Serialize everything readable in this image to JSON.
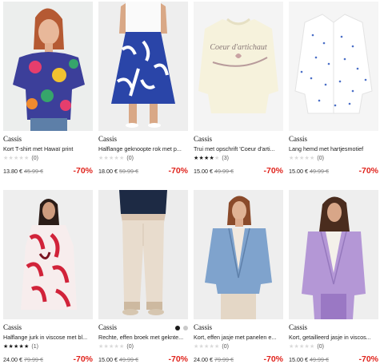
{
  "colors": {
    "discount": "#e0231c",
    "star_on": "#1a1a1a",
    "star_off": "#d9d9d9"
  },
  "products": [
    {
      "brand": "Cassis",
      "title": "Kort T-shirt met Hawaï print",
      "stars": 0,
      "reviews": "(0)",
      "price": "13.80 €",
      "old_price": "45.99 €",
      "discount": "-70%",
      "image": "hawaii-shirt-model"
    },
    {
      "brand": "Cassis",
      "title": "Halflange geknoopte rok met p...",
      "stars": 0,
      "reviews": "(0)",
      "price": "18.00 €",
      "old_price": "59.99 €",
      "discount": "-70%",
      "image": "blue-print-skirt-model"
    },
    {
      "brand": "Cassis",
      "title": "Trui met opschrift 'Coeur d'arti...",
      "stars": 3.5,
      "reviews": "(3)",
      "price": "15.00 €",
      "old_price": "49.99 €",
      "discount": "-70%",
      "image": "sweater-coeur-dartichaut",
      "print_text": "Coeur d'artichaut"
    },
    {
      "brand": "Cassis",
      "title": "Lang hemd met hartjesmotief",
      "stars": 0,
      "reviews": "(0)",
      "price": "15.00 €",
      "old_price": "49.99 €",
      "discount": "-70%",
      "image": "white-heart-shirt"
    },
    {
      "brand": "Cassis",
      "title": "Halflange jurk in viscose met bl...",
      "stars": 5,
      "reviews": "(1)",
      "price": "24.00 €",
      "old_price": "79.99 €",
      "discount": "-70%",
      "image": "floral-dress-model"
    },
    {
      "brand": "Cassis",
      "title": "Rechte, effen broek met geknte...",
      "stars": 0,
      "reviews": "(0)",
      "price": "15.00 €",
      "old_price": "49.99 €",
      "discount": "-70%",
      "image": "beige-trousers-model",
      "swatches": [
        "#1a1a1a",
        "#c9c9c9"
      ]
    },
    {
      "brand": "Cassis",
      "title": "Kort, effen jasje met panelen e...",
      "stars": 0,
      "reviews": "(0)",
      "price": "24.00 €",
      "old_price": "79.99 €",
      "discount": "-70%",
      "image": "blue-jacket-model"
    },
    {
      "brand": "Cassis",
      "title": "Kort, getailleerd jasje in viscos...",
      "stars": 0,
      "reviews": "(0)",
      "price": "15.00 €",
      "old_price": "49.99 €",
      "discount": "-70%",
      "image": "lilac-blazer-model"
    }
  ]
}
